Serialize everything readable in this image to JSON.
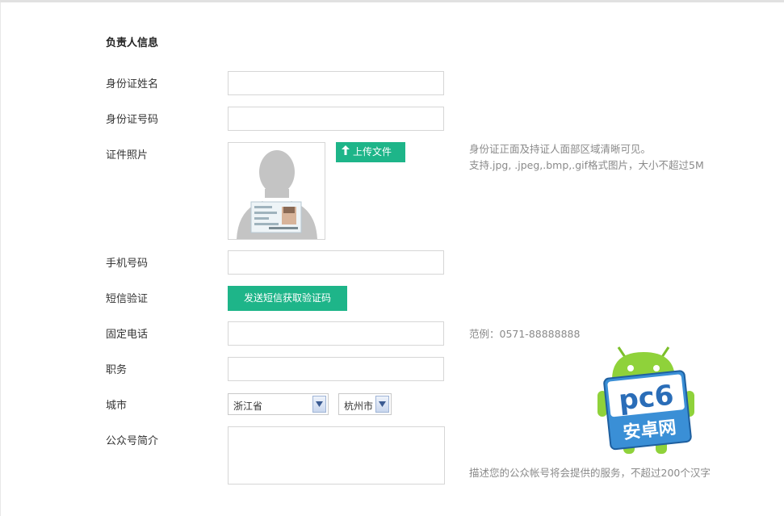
{
  "section": {
    "title": "负责人信息"
  },
  "fields": {
    "id_name": {
      "label": "身份证姓名",
      "value": ""
    },
    "id_number": {
      "label": "身份证号码",
      "value": ""
    },
    "id_photo": {
      "label": "证件照片",
      "upload_label": "上传文件",
      "hint_line1": "身份证正面及持证人面部区域清晰可见。",
      "hint_line2": "支持.jpg, .jpeg,.bmp,.gif格式图片，大小不超过5M"
    },
    "phone": {
      "label": "手机号码",
      "value": ""
    },
    "sms": {
      "label": "短信验证",
      "button_label": "发送短信获取验证码"
    },
    "landline": {
      "label": "固定电话",
      "value": "",
      "hint": "范例：0571-88888888"
    },
    "position": {
      "label": "职务",
      "value": ""
    },
    "city": {
      "label": "城市",
      "province_value": "浙江省",
      "city_value": "杭州市"
    },
    "intro": {
      "label": "公众号简介",
      "value": "",
      "hint": "描述您的公众帐号将会提供的服务，不超过200个汉字"
    }
  },
  "watermark": {
    "text_top": "pc6",
    "text_bottom": "安卓网"
  },
  "colors": {
    "accent": "#1eb589",
    "hint": "#8a8a8a",
    "border": "#d6d6d6"
  }
}
